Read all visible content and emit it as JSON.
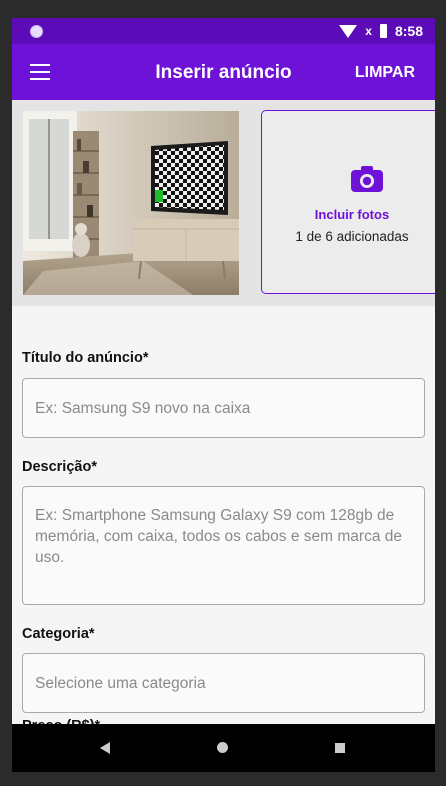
{
  "status_bar": {
    "time": "8:58",
    "signal_glyph": "x"
  },
  "app_bar": {
    "title": "Inserir anúncio",
    "clear_label": "LIMPAR"
  },
  "photos": {
    "add_label": "Incluir fotos",
    "count_text": "1 de 6 adicionadas"
  },
  "form": {
    "title_label": "Título do anúncio*",
    "title_placeholder": "Ex: Samsung S9 novo na caixa",
    "description_label": "Descrição*",
    "description_placeholder": "Ex: Smartphone Samsung Galaxy S9 com 128gb de memória, com caixa, todos os cabos e sem marca de uso.",
    "category_label": "Categoria*",
    "category_placeholder": "Selecione uma categoria",
    "price_label": "Preço (R$)*"
  },
  "colors": {
    "accent": "#6f12d8",
    "status_bar": "#5c0bb8"
  }
}
